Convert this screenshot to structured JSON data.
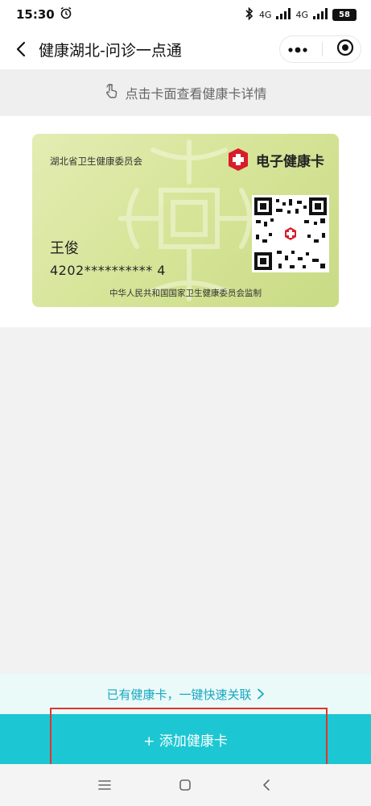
{
  "status_bar": {
    "time": "15:30",
    "network_1": "4G",
    "network_2": "4G",
    "battery": "58"
  },
  "nav": {
    "title": "健康湖北-问诊一点通"
  },
  "hint": {
    "text": "点击卡面查看健康卡详情"
  },
  "card": {
    "issuer": "湖北省卫生健康委员会",
    "brand": "电子健康卡",
    "name": "王俊",
    "id_number": "4202**********  4",
    "supervisor": "中华人民共和国国家卫生健康委员会监制"
  },
  "actions": {
    "link_label": "已有健康卡，一键快速关联",
    "add_label": "+ 添加健康卡"
  },
  "colors": {
    "accent": "#1cc7d3",
    "link": "#18a7c2",
    "highlight": "#e0352b",
    "card_bg": "#d7e59a"
  }
}
